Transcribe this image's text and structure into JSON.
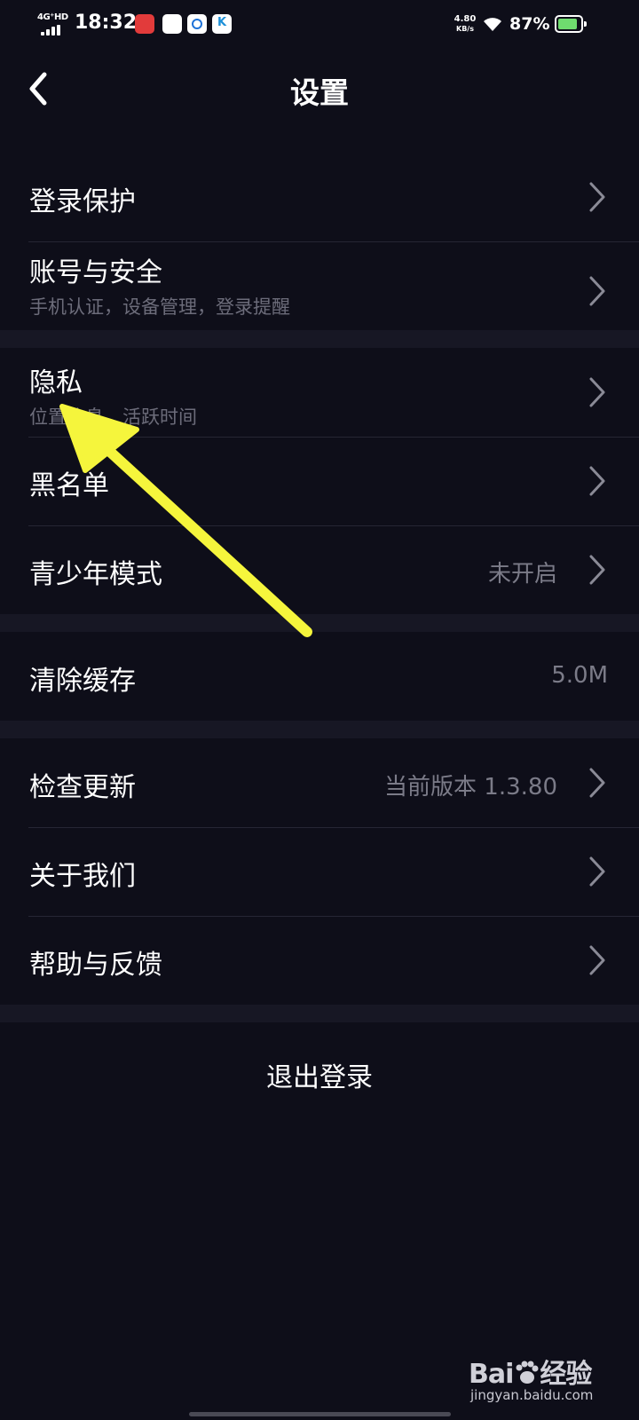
{
  "status_bar": {
    "network": "4G⁺HD",
    "time": "18:32",
    "speed_value": "4.80",
    "speed_unit": "KB/s",
    "battery": "87%",
    "battery_level": 0.87
  },
  "header": {
    "title": "设置"
  },
  "groups": [
    {
      "items": [
        {
          "label": "登录保护",
          "chevron": true
        },
        {
          "label": "账号与安全",
          "subtitle": "手机认证，设备管理，登录提醒",
          "chevron": true
        }
      ]
    },
    {
      "items": [
        {
          "label": "隐私",
          "subtitle": "位置信息，活跃时间",
          "chevron": true
        },
        {
          "label": "黑名单",
          "chevron": true
        },
        {
          "label": "青少年模式",
          "value": "未开启",
          "chevron": true
        }
      ]
    },
    {
      "items": [
        {
          "label": "清除缓存",
          "value": "5.0M",
          "chevron": false
        }
      ]
    },
    {
      "items": [
        {
          "label": "检查更新",
          "value": "当前版本 1.3.80",
          "chevron": true
        },
        {
          "label": "关于我们",
          "chevron": true
        },
        {
          "label": "帮助与反馈",
          "chevron": true
        }
      ]
    }
  ],
  "logout": {
    "label": "退出登录"
  },
  "annotation": {
    "color": "#f5f53c"
  },
  "watermark": {
    "logo_left": "Bai",
    "logo_right": "经验",
    "url": "jingyan.baidu.com"
  }
}
